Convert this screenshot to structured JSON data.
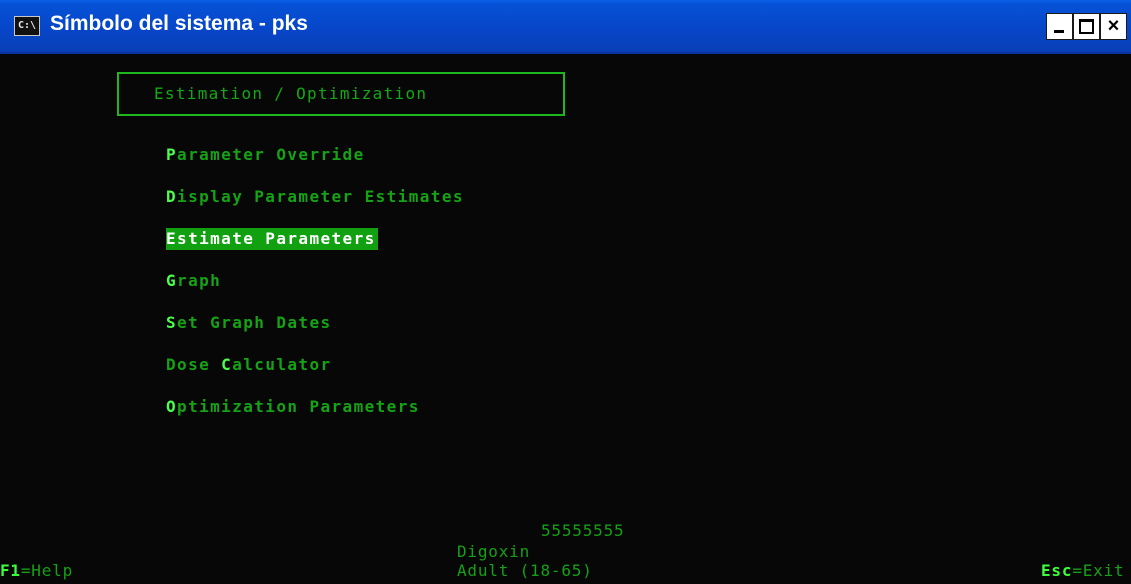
{
  "window": {
    "title": "Símbolo del sistema - pks",
    "icon_label": "C:\\",
    "controls": {
      "minimize": "minimize-icon",
      "maximize": "maximize-icon",
      "close": "×"
    }
  },
  "menu": {
    "title": "Estimation / Optimization",
    "items": [
      {
        "hot": "P",
        "pre": "",
        "rest": "arameter Override",
        "selected": false
      },
      {
        "hot": "D",
        "pre": "",
        "rest": "isplay Parameter Estimates",
        "selected": false
      },
      {
        "hot": "E",
        "pre": "",
        "rest": "stimate Parameters",
        "selected": true
      },
      {
        "hot": "G",
        "pre": "",
        "rest": "raph",
        "selected": false
      },
      {
        "hot": "S",
        "pre": "",
        "rest": "et Graph Dates",
        "selected": false
      },
      {
        "hot": "C",
        "pre": "Dose ",
        "rest": "alculator",
        "selected": false
      },
      {
        "hot": "O",
        "pre": "",
        "rest": "ptimization Parameters",
        "selected": false
      }
    ]
  },
  "status": {
    "patient_id": "55555555",
    "drug": "Digoxin",
    "population": "Adult (18-65)",
    "help_key": "F1",
    "help_label": "=Help",
    "exit_key": "Esc",
    "exit_label": "=Exit"
  },
  "colors": {
    "console_bg": "#070707",
    "text_green": "#13a313",
    "hotkey_green": "#4cff4c",
    "selected_bg": "#10a010",
    "titlebar_blue": "#0746c9"
  }
}
